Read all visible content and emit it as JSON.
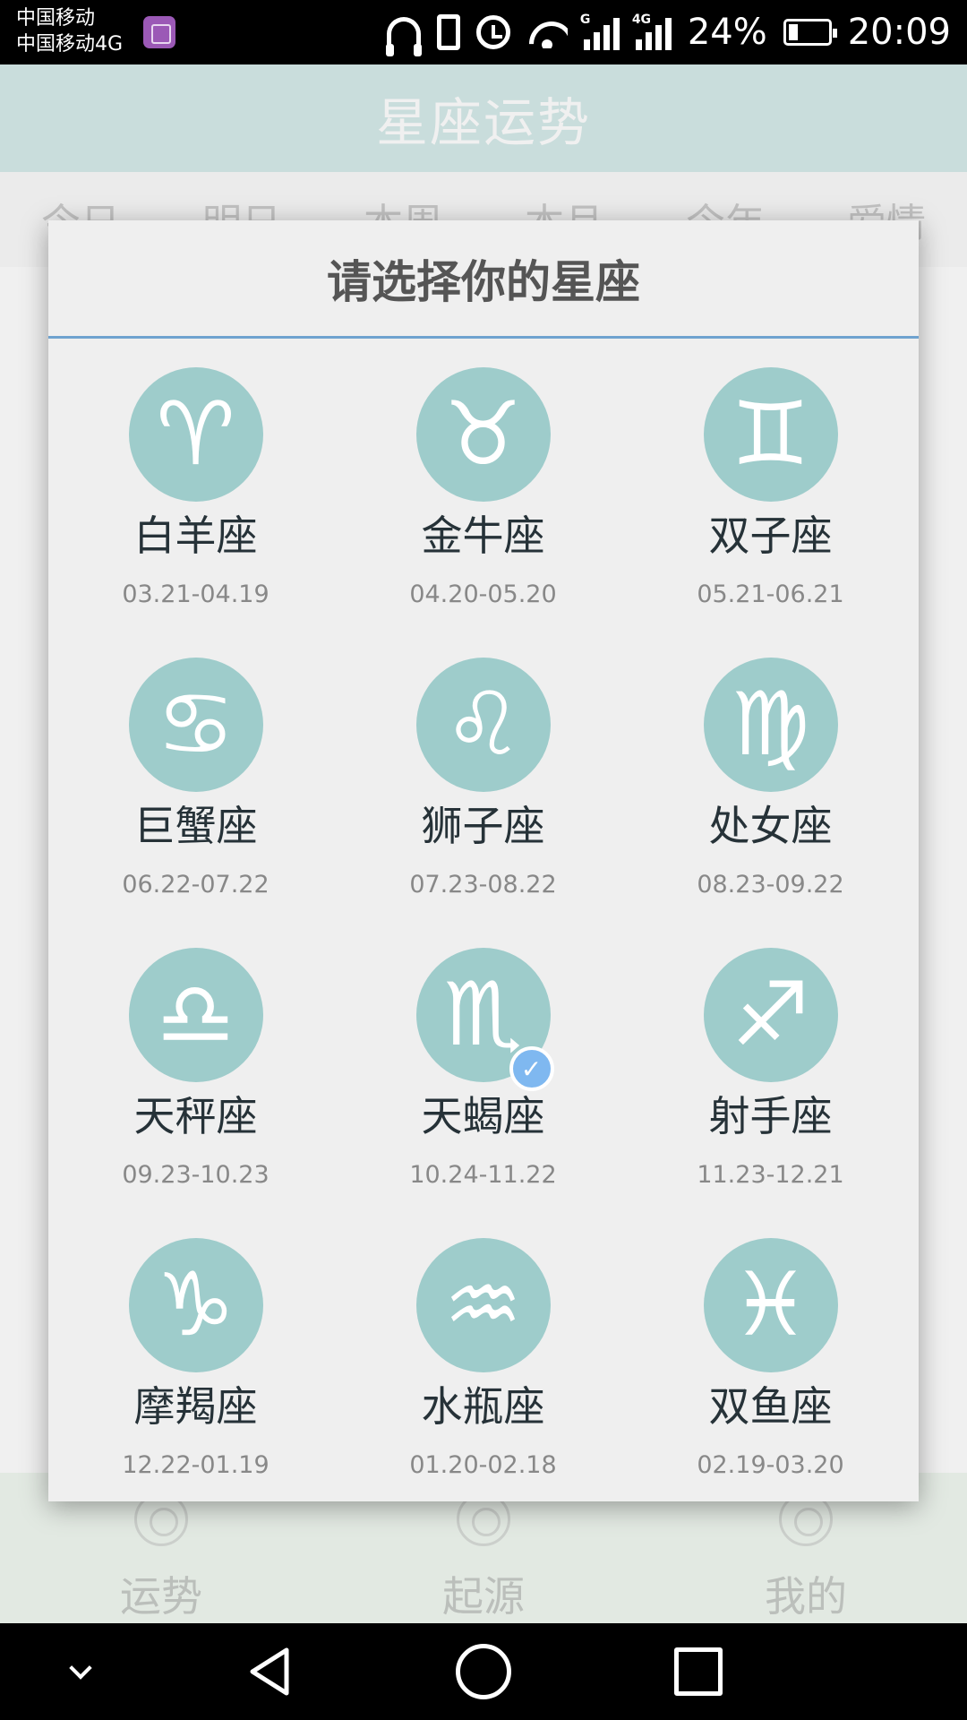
{
  "status_bar": {
    "carrier_1": "中国移动",
    "carrier_2": "中国移动4G",
    "signal_1_label": "G",
    "signal_2_label": "4G",
    "battery_text": "24%",
    "battery_level": 0.24,
    "time": "20:09"
  },
  "header": {
    "title": "星座运势"
  },
  "tabs": [
    "今日",
    "明日",
    "本周",
    "本月",
    "今年",
    "爱情"
  ],
  "dialog": {
    "title": "请选择你的星座",
    "selected_sign": "天蝎座",
    "check_glyph": "✓",
    "signs": [
      {
        "name": "白羊座",
        "dates": "03.21-04.19",
        "glyph": "♈",
        "icon": "aries-icon"
      },
      {
        "name": "金牛座",
        "dates": "04.20-05.20",
        "glyph": "♉",
        "icon": "taurus-icon"
      },
      {
        "name": "双子座",
        "dates": "05.21-06.21",
        "glyph": "♊",
        "icon": "gemini-icon"
      },
      {
        "name": "巨蟹座",
        "dates": "06.22-07.22",
        "glyph": "♋",
        "icon": "cancer-icon"
      },
      {
        "name": "狮子座",
        "dates": "07.23-08.22",
        "glyph": "♌",
        "icon": "leo-icon"
      },
      {
        "name": "处女座",
        "dates": "08.23-09.22",
        "glyph": "♍",
        "icon": "virgo-icon"
      },
      {
        "name": "天秤座",
        "dates": "09.23-10.23",
        "glyph": "♎",
        "icon": "libra-icon"
      },
      {
        "name": "天蝎座",
        "dates": "10.24-11.22",
        "glyph": "♏",
        "icon": "scorpio-icon"
      },
      {
        "name": "射手座",
        "dates": "11.23-12.21",
        "glyph": "♐",
        "icon": "sagittarius-icon"
      },
      {
        "name": "摩羯座",
        "dates": "12.22-01.19",
        "glyph": "♑",
        "icon": "capricorn-icon"
      },
      {
        "name": "水瓶座",
        "dates": "01.20-02.18",
        "glyph": "♒",
        "icon": "aquarius-icon"
      },
      {
        "name": "双鱼座",
        "dates": "02.19-03.20",
        "glyph": "♓",
        "icon": "pisces-icon"
      }
    ]
  },
  "bottom_nav": {
    "items": [
      "运势",
      "起源",
      "我的"
    ]
  },
  "colors": {
    "header_bg": "#d6ebea",
    "sign_circle": "#9ecccb",
    "dialog_divider": "#6fa3cf",
    "check_badge": "#7fb8f0",
    "bottom_nav_bg": "#f1f8f1"
  }
}
